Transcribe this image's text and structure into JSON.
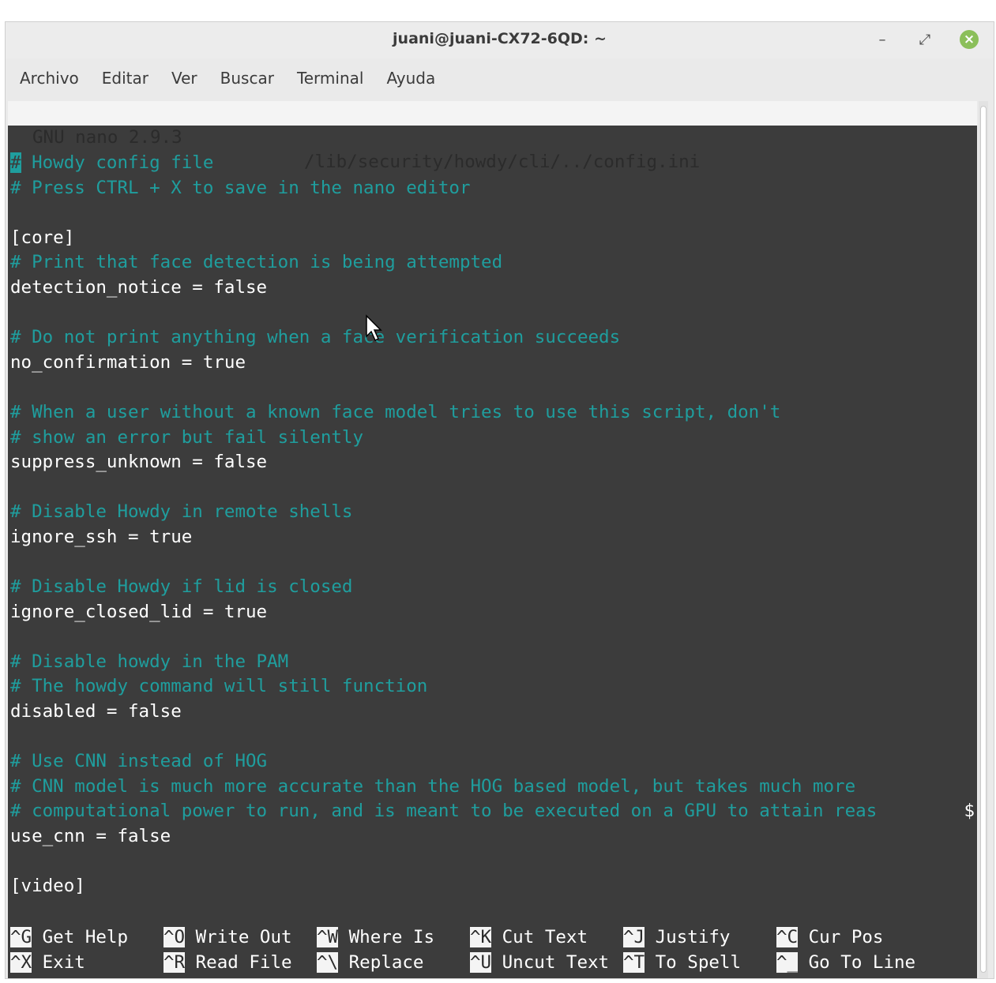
{
  "window": {
    "title": "juani@juani-CX72-6QD: ~"
  },
  "menu": [
    "Archivo",
    "Editar",
    "Ver",
    "Buscar",
    "Terminal",
    "Ayuda"
  ],
  "nano": {
    "version": "GNU nano 2.9.3",
    "filename": "/lib/security/howdy/cli/../config.ini",
    "overflow_marker": "$"
  },
  "lines": [
    {
      "type": "comment-cursor",
      "hash": "#",
      "text": " Howdy config file"
    },
    {
      "type": "comment",
      "text": "# Press CTRL + X to save in the nano editor"
    },
    {
      "type": "blank",
      "text": ""
    },
    {
      "type": "code",
      "text": "[core]"
    },
    {
      "type": "comment",
      "text": "# Print that face detection is being attempted"
    },
    {
      "type": "code",
      "text": "detection_notice = false"
    },
    {
      "type": "blank",
      "text": ""
    },
    {
      "type": "comment",
      "text": "# Do not print anything when a face verification succeeds"
    },
    {
      "type": "code",
      "text": "no_confirmation = true"
    },
    {
      "type": "blank",
      "text": ""
    },
    {
      "type": "comment",
      "text": "# When a user without a known face model tries to use this script, don't"
    },
    {
      "type": "comment",
      "text": "# show an error but fail silently"
    },
    {
      "type": "code",
      "text": "suppress_unknown = false"
    },
    {
      "type": "blank",
      "text": ""
    },
    {
      "type": "comment",
      "text": "# Disable Howdy in remote shells"
    },
    {
      "type": "code",
      "text": "ignore_ssh = true"
    },
    {
      "type": "blank",
      "text": ""
    },
    {
      "type": "comment",
      "text": "# Disable Howdy if lid is closed"
    },
    {
      "type": "code",
      "text": "ignore_closed_lid = true"
    },
    {
      "type": "blank",
      "text": ""
    },
    {
      "type": "comment",
      "text": "# Disable howdy in the PAM"
    },
    {
      "type": "comment",
      "text": "# The howdy command will still function"
    },
    {
      "type": "code",
      "text": "disabled = false"
    },
    {
      "type": "blank",
      "text": ""
    },
    {
      "type": "comment",
      "text": "# Use CNN instead of HOG"
    },
    {
      "type": "comment",
      "text": "# CNN model is much more accurate than the HOG based model, but takes much more"
    },
    {
      "type": "comment-overflow",
      "text": "# computational power to run, and is meant to be executed on a GPU to attain reas"
    },
    {
      "type": "code",
      "text": "use_cnn = false"
    },
    {
      "type": "blank",
      "text": ""
    },
    {
      "type": "code",
      "text": "[video]"
    }
  ],
  "shortcuts": {
    "row1": [
      {
        "key": "^G",
        "label": "Get Help"
      },
      {
        "key": "^O",
        "label": "Write Out"
      },
      {
        "key": "^W",
        "label": "Where Is"
      },
      {
        "key": "^K",
        "label": "Cut Text"
      },
      {
        "key": "^J",
        "label": "Justify"
      },
      {
        "key": "^C",
        "label": "Cur Pos"
      }
    ],
    "row2": [
      {
        "key": "^X",
        "label": "Exit"
      },
      {
        "key": "^R",
        "label": "Read File"
      },
      {
        "key": "^\\",
        "label": "Replace"
      },
      {
        "key": "^U",
        "label": "Uncut Text"
      },
      {
        "key": "^T",
        "label": "To Spell"
      },
      {
        "key": "^_",
        "label": "Go To Line"
      }
    ]
  },
  "icons": {
    "minimize": "minimize-icon",
    "maximize": "maximize-icon",
    "close": "close-icon",
    "pointer": "mouse-pointer-icon"
  },
  "colors": {
    "terminal_bg": "#3c3c3c",
    "comment": "#1f9e9e",
    "text": "#ffffff",
    "close_button": "#8bbf5a"
  }
}
